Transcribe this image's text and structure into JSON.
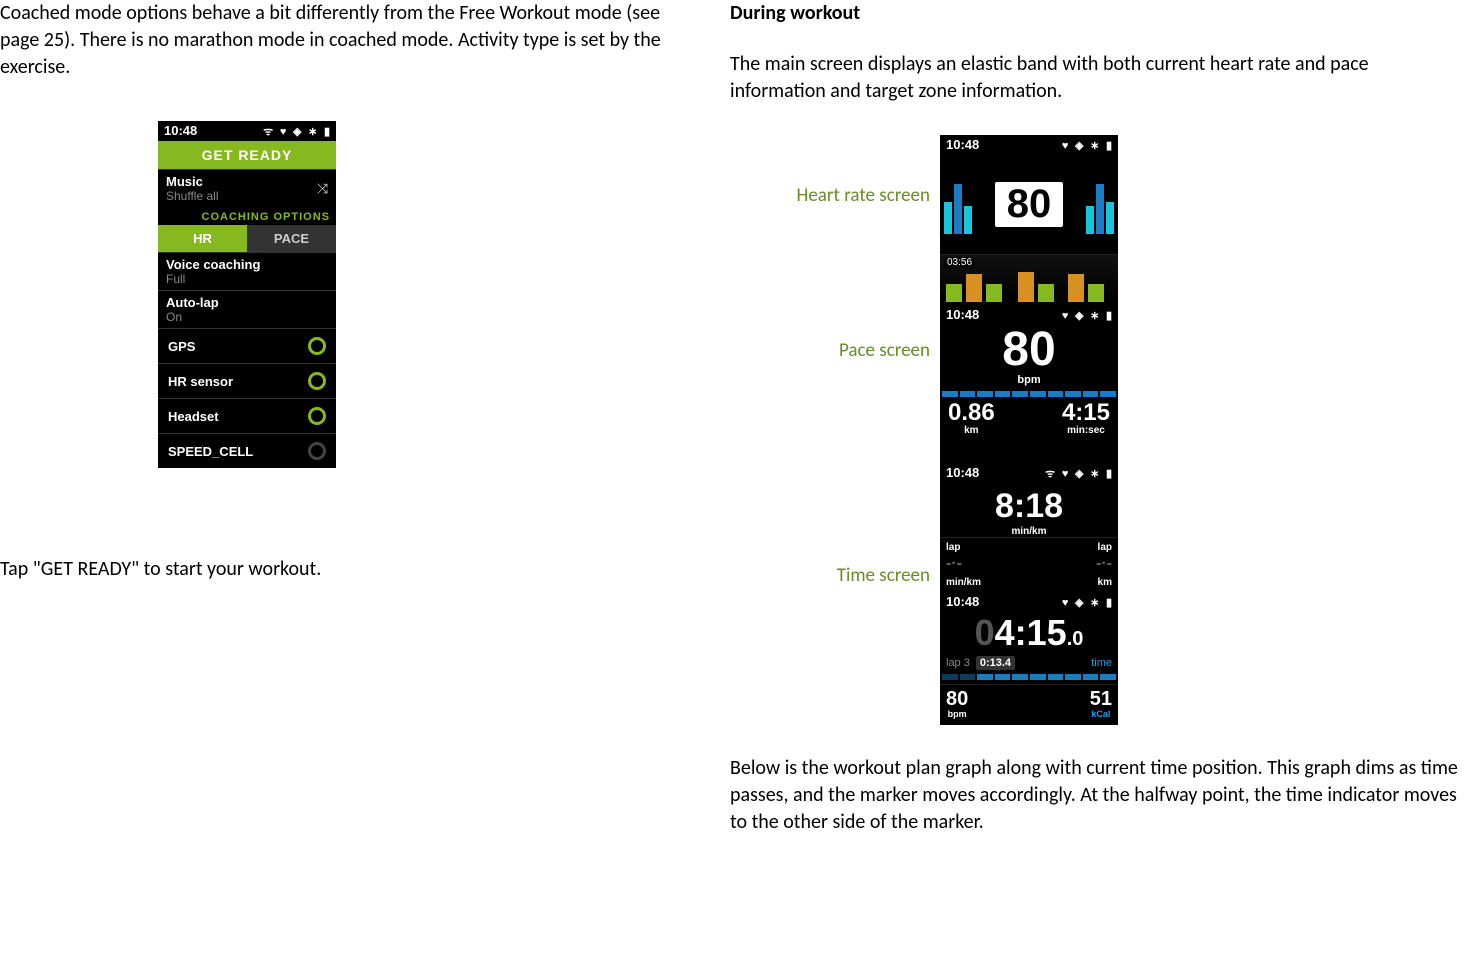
{
  "left": {
    "p1": "Coached mode options behave a bit differently from the Free Workout mode (see page 25). There is no marathon mode in coached mode. Activity type is set by the exercise.",
    "p2": "Tap \"GET READY\" to start your workout.",
    "device": {
      "time": "10:48",
      "get_ready": "GET READY",
      "music_lbl": "Music",
      "music_val": "Shuffle all",
      "coaching_hdr": "COACHING OPTIONS",
      "tab_hr": "HR",
      "tab_pace": "PACE",
      "voice_lbl": "Voice coaching",
      "voice_val": "Full",
      "autolap_lbl": "Auto-lap",
      "autolap_val": "On",
      "gps": "GPS",
      "hrsensor": "HR sensor",
      "headset": "Headset",
      "speedcell": "SPEED_CELL"
    }
  },
  "right": {
    "h1": "During workout",
    "p1": "The main screen displays an elastic band with both current heart rate and pace information and target zone information.",
    "p2": "Below is the workout plan graph along with current time position. This graph dims as time passes, and the marker moves accordingly. At the halfway point, the time indicator moves to the other side of the marker.",
    "label_hr": "Heart rate screen",
    "label_pace": "Pace screen",
    "label_time": "Time screen",
    "hr": {
      "time": "10:48",
      "val": "80",
      "graph_time": "03:56"
    },
    "pace": {
      "time": "10:48",
      "bpm": "80",
      "bpm_u": "bpm",
      "km": "0.86",
      "km_u": "km",
      "dur": "4:15",
      "dur_u": "min:sec"
    },
    "time": {
      "time1": "10:48",
      "minkm": "8:18",
      "minkm_u": "min/km",
      "lap": "lap",
      "u1": "min/km",
      "u2": "km",
      "time2": "10:48",
      "dur": "4:15",
      "dur_dec": ".0",
      "lap_n": "lap 3",
      "lap_t": "0:13.4",
      "time_lbl": "time",
      "bpm": "80",
      "bpm_u": "bpm",
      "kcal": "51",
      "kcal_u": "kCal"
    }
  }
}
